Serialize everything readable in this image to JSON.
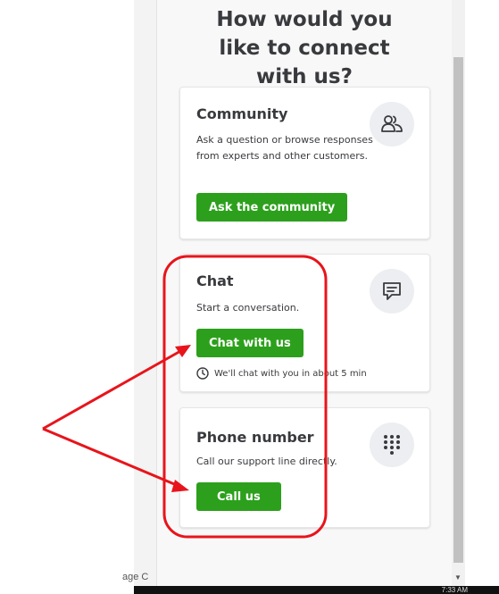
{
  "header": {
    "title": "How would you like to connect with us?"
  },
  "cards": {
    "community": {
      "title": "Community",
      "description": "Ask a question or browse responses from experts and other customers.",
      "button": "Ask the community",
      "icon": "people-icon"
    },
    "chat": {
      "title": "Chat",
      "description": "Start a conversation.",
      "button": "Chat with us",
      "wait_text": "We'll chat with you in about 5 min",
      "icon": "chat-bubble-icon"
    },
    "phone": {
      "title": "Phone number",
      "description": "Call our support line directly.",
      "button": "Call us",
      "icon": "dialpad-icon"
    }
  },
  "background": {
    "page_hint": "age C",
    "taskbar_time": "7:33 AM"
  },
  "colors": {
    "accent": "#2ca01c",
    "text": "#393a3d",
    "annotation": "#e8141b"
  }
}
